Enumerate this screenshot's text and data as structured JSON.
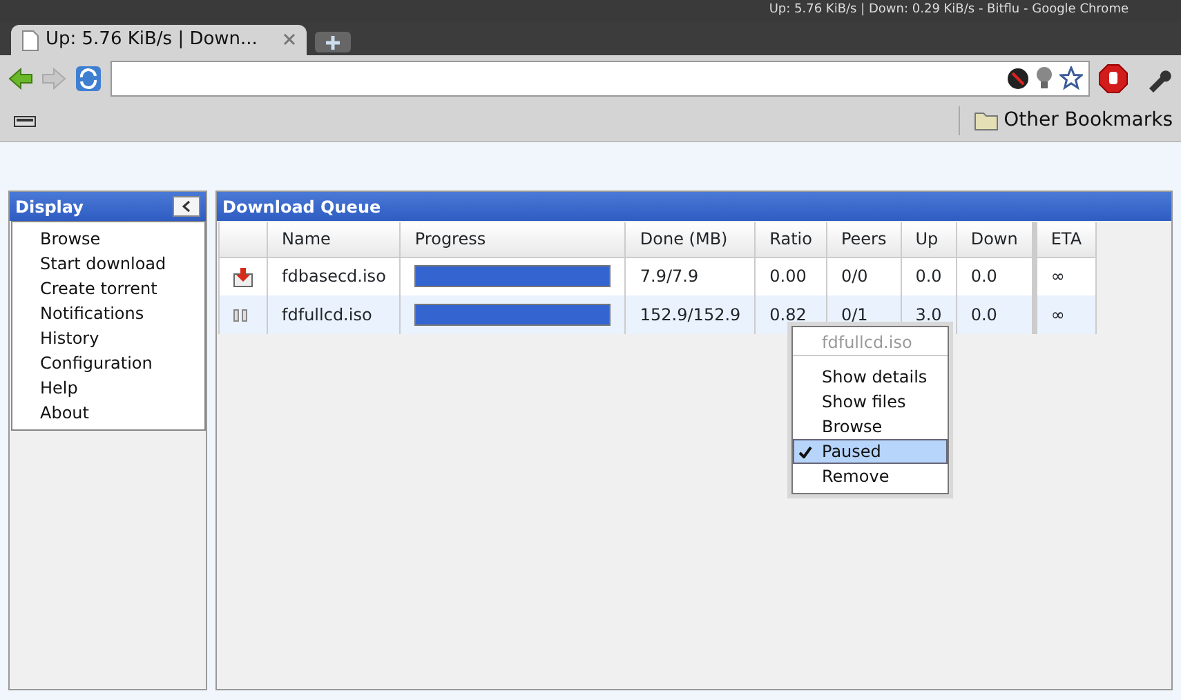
{
  "window": {
    "title": "Up: 5.76 KiB/s | Down: 0.29 KiB/s - Bitflu - Google Chrome"
  },
  "tabs": [
    {
      "label": "Up: 5.76 KiB/s | Down...",
      "selected": true
    }
  ],
  "bookmarks_bar": {
    "other": "Other Bookmarks"
  },
  "sidebar": {
    "title": "Display",
    "items": [
      {
        "label": "Browse"
      },
      {
        "label": "Start download"
      },
      {
        "label": "Create torrent"
      },
      {
        "label": "Notifications"
      },
      {
        "label": "History"
      },
      {
        "label": "Configuration"
      },
      {
        "label": "Help"
      },
      {
        "label": "About"
      }
    ]
  },
  "queue": {
    "title": "Download Queue",
    "columns": [
      "Name",
      "Progress",
      "Done (MB)",
      "Ratio",
      "Peers",
      "Up",
      "Down",
      "ETA"
    ],
    "rows": [
      {
        "kind": "downloading",
        "name": "fdbasecd.iso",
        "level": 1.0,
        "done": "7.9/7.9",
        "ratio": "0.00",
        "peers": "0/0",
        "up": "0.0",
        "down": "0.0",
        "eta": "∞",
        "selected": false
      },
      {
        "kind": "paused",
        "name": "fdfullcd.iso",
        "level": 1.0,
        "done": "152.9/152.9",
        "ratio": "0.82",
        "peers": "0/1",
        "up": "3.0",
        "down": "0.0",
        "eta": "∞",
        "selected": true
      }
    ]
  },
  "context_menu": {
    "title": "fdfullcd.iso",
    "items": [
      {
        "label": "Show details",
        "checked": false,
        "selected": false
      },
      {
        "label": "Show files",
        "checked": false,
        "selected": false
      },
      {
        "label": "Browse",
        "checked": false,
        "selected": false
      },
      {
        "label": "Paused",
        "checked": true,
        "selected": true
      },
      {
        "label": "Remove",
        "checked": false,
        "selected": false
      }
    ]
  }
}
